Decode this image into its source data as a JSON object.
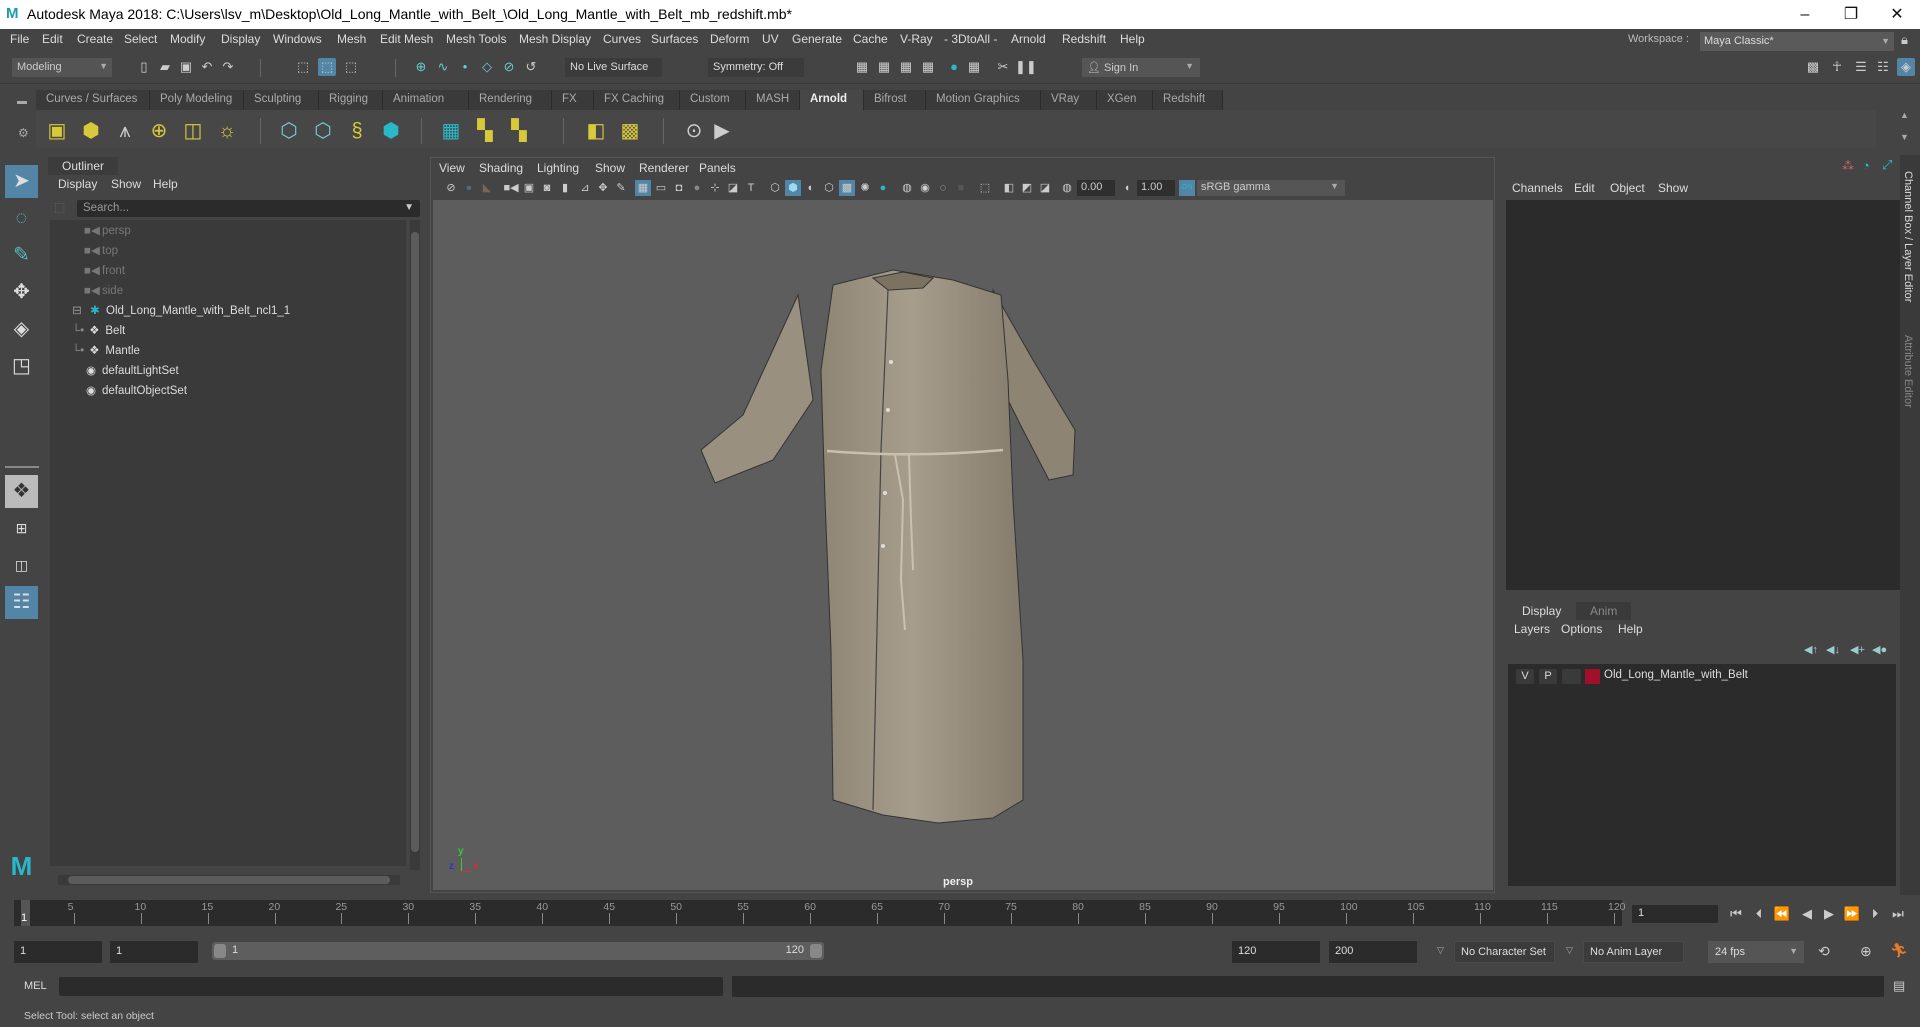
{
  "window": {
    "title": "Autodesk Maya 2018: C:\\Users\\lsv_m\\Desktop\\Old_Long_Mantle_with_Belt_\\Old_Long_Mantle_with_Belt_mb_redshift.mb*",
    "logo": "M",
    "minimize": "–",
    "maximize": "❐",
    "close": "✕"
  },
  "menubar": {
    "items": [
      "File",
      "Edit",
      "Create",
      "Select",
      "Modify",
      "Display",
      "Windows",
      "Mesh",
      "Edit Mesh",
      "Mesh Tools",
      "Mesh Display",
      "Curves",
      "Surfaces",
      "Deform",
      "UV",
      "Generate",
      "Cache",
      "V-Ray",
      "- 3DtoAll -",
      "Arnold",
      "Redshift",
      "Help"
    ],
    "workspace_label": "Workspace :",
    "workspace_value": "Maya Classic*"
  },
  "statusline": {
    "mode": "Modeling",
    "live_surface": "No Live Surface",
    "symmetry": "Symmetry: Off",
    "sign_in": "Sign In"
  },
  "shelf": {
    "tabs": [
      "Curves / Surfaces",
      "Poly Modeling",
      "Sculpting",
      "Rigging",
      "Animation",
      "Rendering",
      "FX",
      "FX Caching",
      "Custom",
      "MASH",
      "Arnold",
      "Bifrost",
      "Motion Graphics",
      "VRay",
      "XGen",
      "Redshift"
    ],
    "active_tab": "Arnold",
    "icons": [
      "area-light",
      "mesh-light",
      "photometric-light",
      "skydome-light",
      "light-portal",
      "physical-sky",
      "standin-create",
      "standin-export",
      "curve-collector",
      "volume",
      "render-view",
      "texture-manager",
      "tx-remove",
      "shader-assign",
      "shader-checker",
      "flush-cache",
      "render-play"
    ]
  },
  "outliner": {
    "tab": "Outliner",
    "menu": [
      "Display",
      "Show",
      "Help"
    ],
    "search_placeholder": "Search...",
    "items": [
      {
        "label": "persp",
        "type": "camera",
        "indent": 1
      },
      {
        "label": "top",
        "type": "camera",
        "indent": 1
      },
      {
        "label": "front",
        "type": "camera",
        "indent": 1
      },
      {
        "label": "side",
        "type": "camera",
        "indent": 1
      },
      {
        "label": "Old_Long_Mantle_with_Belt_ncl1_1",
        "type": "group",
        "indent": 0
      },
      {
        "label": "Belt",
        "type": "mesh",
        "indent": 2
      },
      {
        "label": "Mantle",
        "type": "mesh",
        "indent": 2
      },
      {
        "label": "defaultLightSet",
        "type": "set",
        "indent": 1
      },
      {
        "label": "defaultObjectSet",
        "type": "set",
        "indent": 1
      }
    ]
  },
  "viewport": {
    "menu": [
      "View",
      "Shading",
      "Lighting",
      "Show",
      "Renderer",
      "Panels"
    ],
    "exposure": "0.00",
    "gamma": "1.00",
    "color_space": "sRGB gamma",
    "color_mgmt_badge": "ON",
    "camera": "persp",
    "axis": {
      "x": "x",
      "y": "y",
      "z": "z"
    }
  },
  "channelbox": {
    "menu": [
      "Channels",
      "Edit",
      "Object",
      "Show"
    ],
    "side_tabs": [
      "Channel Box / Layer Editor",
      "Attribute Editor"
    ]
  },
  "layereditor": {
    "tabs": [
      "Display",
      "Anim"
    ],
    "active_tab": "Display",
    "menu": [
      "Layers",
      "Options",
      "Help"
    ],
    "layers": [
      {
        "visible": "V",
        "playback": "P",
        "name": "Old_Long_Mantle_with_Belt",
        "color": "#a0102a"
      }
    ]
  },
  "timeslider": {
    "start": 1,
    "end": 120,
    "ticks": [
      5,
      10,
      15,
      20,
      25,
      30,
      35,
      40,
      45,
      50,
      55,
      60,
      65,
      70,
      75,
      80,
      85,
      90,
      95,
      100,
      105,
      110,
      115,
      120
    ],
    "current_frame": "1",
    "current_frame_field": "1"
  },
  "rangeslider": {
    "anim_start": "1",
    "playback_start": "1",
    "range_start_label": "1",
    "range_end_label": "120",
    "playback_end": "120",
    "anim_end": "200",
    "character_set": "No Character Set",
    "anim_layer": "No Anim Layer",
    "fps": "24 fps"
  },
  "commandline": {
    "label": "MEL",
    "help_text": "Select Tool: select an object"
  }
}
